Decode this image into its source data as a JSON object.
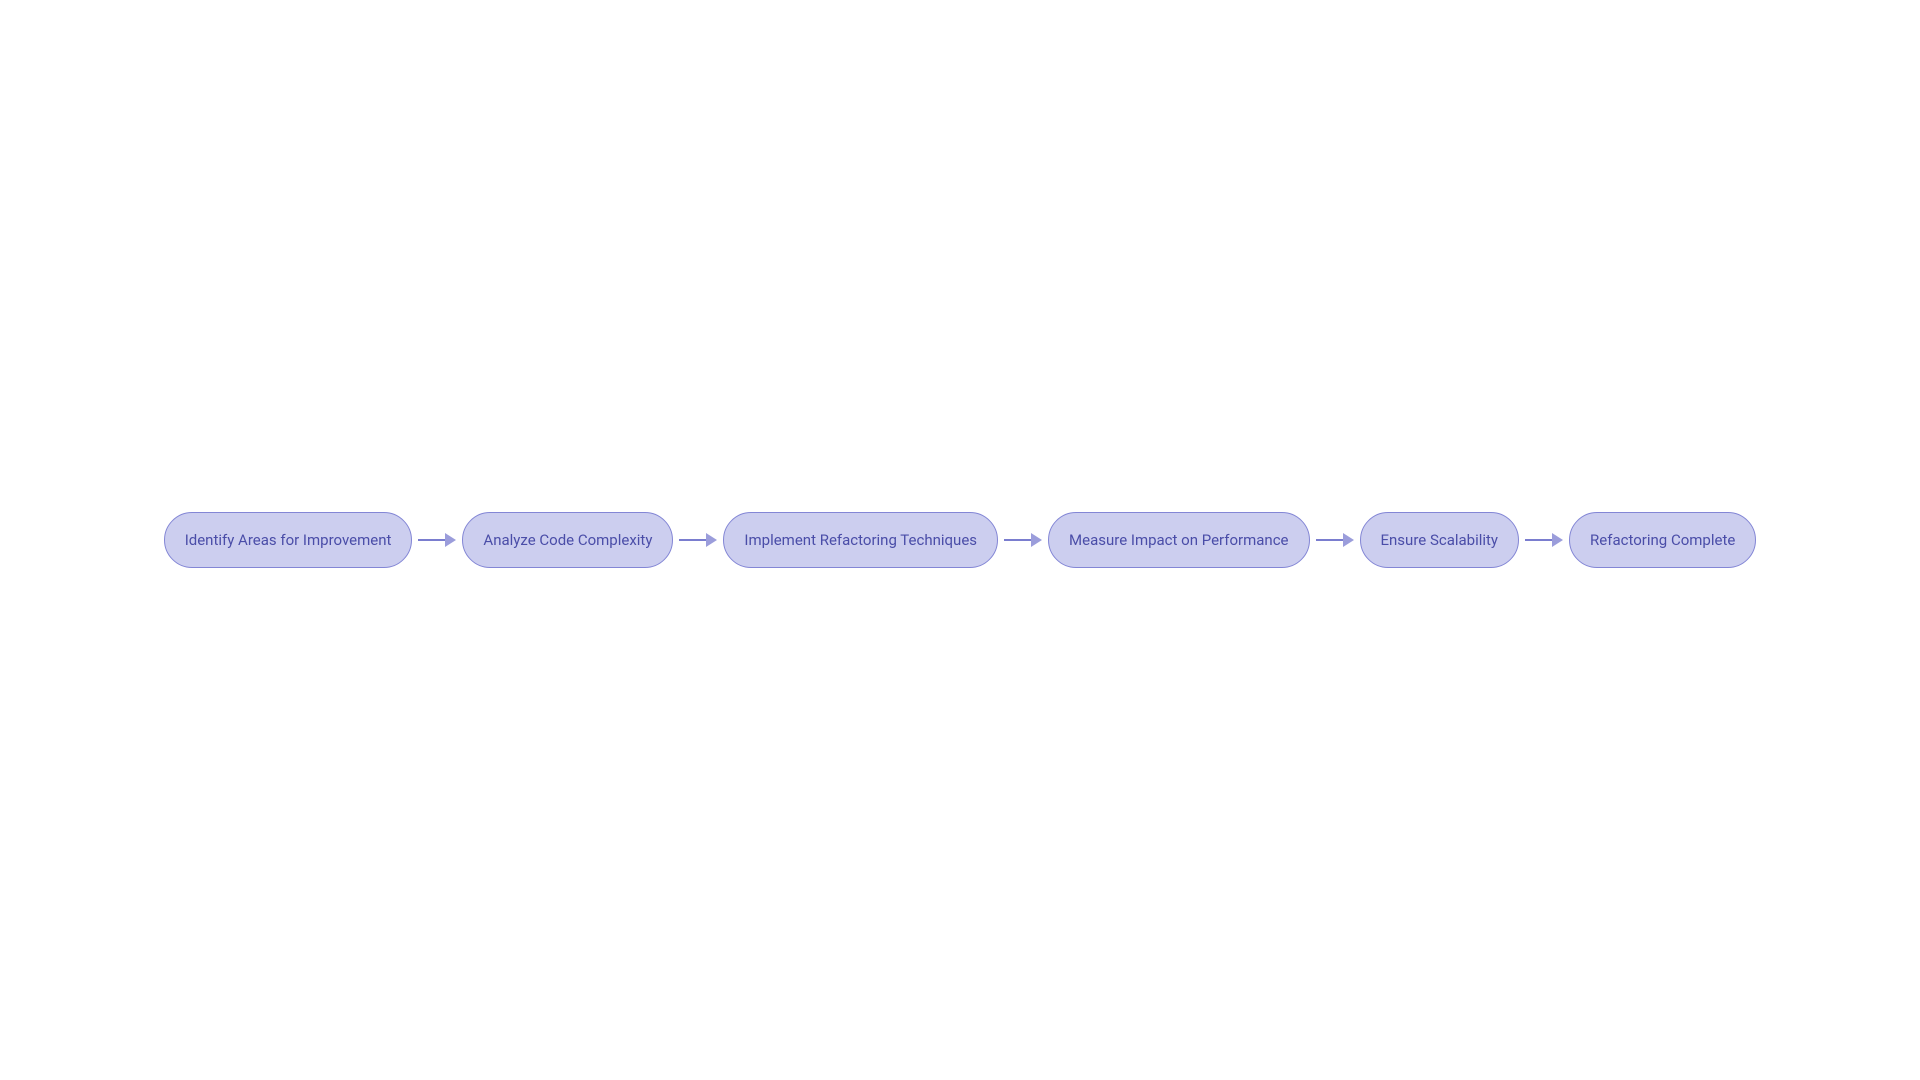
{
  "diagram": {
    "nodes": [
      {
        "id": "node-1",
        "label": "Identify Areas for Improvement"
      },
      {
        "id": "node-2",
        "label": "Analyze Code Complexity"
      },
      {
        "id": "node-3",
        "label": "Implement Refactoring Techniques"
      },
      {
        "id": "node-4",
        "label": "Measure Impact on Performance"
      },
      {
        "id": "node-5",
        "label": "Ensure Scalability"
      },
      {
        "id": "node-6",
        "label": "Refactoring Complete"
      }
    ]
  }
}
